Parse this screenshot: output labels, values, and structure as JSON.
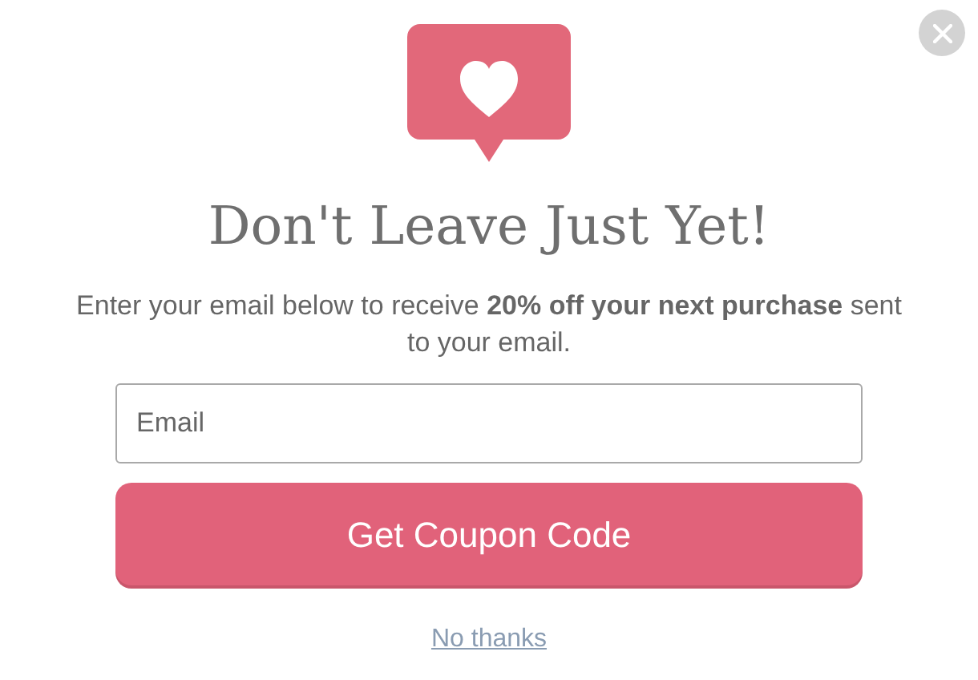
{
  "title": "Don't Leave Just Yet!",
  "message": "Enter your email below to receive **20% off your next purchase** sent to your email.",
  "email_field": {
    "placeholder": "Email"
  },
  "submit_button": "Get Coupon Code",
  "decline_link": "No thanks"
}
